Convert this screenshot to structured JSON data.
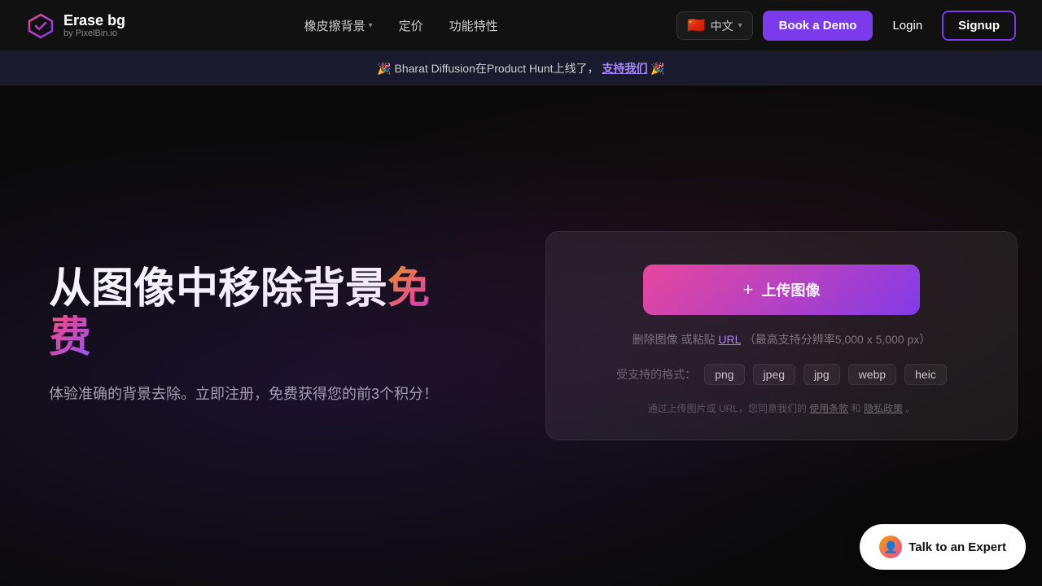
{
  "logo": {
    "name": "Erase bg",
    "sub": "by PixelBin.io"
  },
  "nav": {
    "items": [
      {
        "label": "橡皮擦背景",
        "hasDropdown": true
      },
      {
        "label": "定价",
        "hasDropdown": false
      },
      {
        "label": "功能特性",
        "hasDropdown": false
      }
    ],
    "lang": {
      "flag": "🇨🇳",
      "text": "中文"
    },
    "book_demo": "Book a Demo",
    "login": "Login",
    "signup": "Signup"
  },
  "announcement": {
    "text": "🎉 Bharat Diffusion在Product Hunt上线了，",
    "link_text": "支持我们",
    "suffix": "🎉"
  },
  "hero": {
    "title_main": "从图像中移除背景",
    "title_highlight": "免费",
    "subtitle": "体验准确的背景去除。立即注册，免费获得您的前3个积分！"
  },
  "upload": {
    "button_label": "上传图像",
    "hint_prefix": "删除图像 或粘贴",
    "hint_url": "URL",
    "hint_suffix": "（最高支持分辨率5,000 x 5,000 px）",
    "formats_label": "受支持的格式：",
    "formats": [
      "png",
      "jpeg",
      "jpg",
      "webp",
      "heic"
    ],
    "terms_prefix": "通过上传图片或 URL，您同意我们的",
    "terms_of_use": "使用条款",
    "terms_and": "和",
    "privacy_policy": "隐私政策",
    "terms_suffix": "。"
  },
  "talk_expert": {
    "label": "Talk to an Expert"
  }
}
